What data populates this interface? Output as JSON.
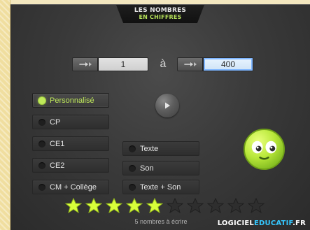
{
  "header": {
    "line1": "LES NOMBRES",
    "line2": "EN CHIFFRES"
  },
  "range": {
    "from_value": "1",
    "separator": "à",
    "to_value": "400"
  },
  "options": {
    "left": [
      {
        "label": "Personnalisé",
        "active": true
      },
      {
        "label": "CP"
      },
      {
        "label": "CE1"
      },
      {
        "label": "CE2"
      },
      {
        "label": "CM + Collège"
      }
    ],
    "mode": [
      {
        "label": "Texte"
      },
      {
        "label": "Son"
      },
      {
        "label": "Texte + Son"
      }
    ]
  },
  "progress": {
    "stars_filled": 5,
    "stars_total": 10,
    "caption": "5 nombres à écrire"
  },
  "logo": {
    "part1": "LOGICIEL",
    "part2": "EDUCATIF",
    "part3": ".FR"
  },
  "colors": {
    "accent_green": "#bfe95a",
    "star_yellow": "#d8ff3a",
    "logo_blue": "#35c8ff"
  },
  "icons": {
    "play": "play-icon",
    "stepper": "stepper-arrow-icon",
    "star": "star-icon",
    "smiley": "smiley-face-icon"
  }
}
